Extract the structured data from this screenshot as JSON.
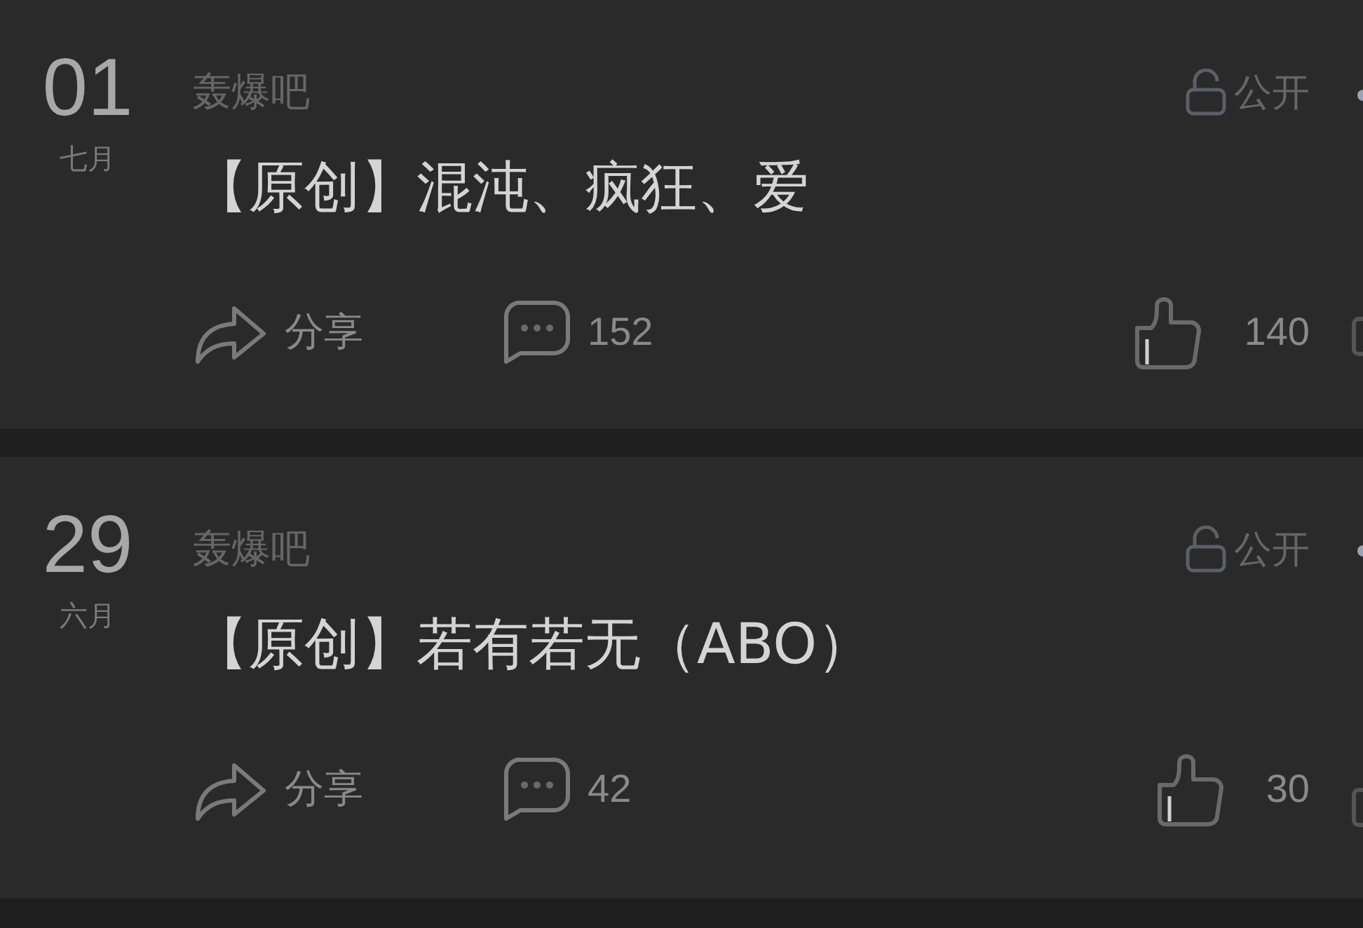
{
  "posts": [
    {
      "day": "01",
      "month": "七月",
      "author": "轰爆吧",
      "visibility": "公开",
      "title": "【原创】混沌、疯狂、爱",
      "share_label": "分享",
      "comments": "152",
      "likes": "140"
    },
    {
      "day": "29",
      "month": "六月",
      "author": "轰爆吧",
      "visibility": "公开",
      "title": "【原创】若有若无（ABO）",
      "share_label": "分享",
      "comments": "42",
      "likes": "30"
    }
  ]
}
